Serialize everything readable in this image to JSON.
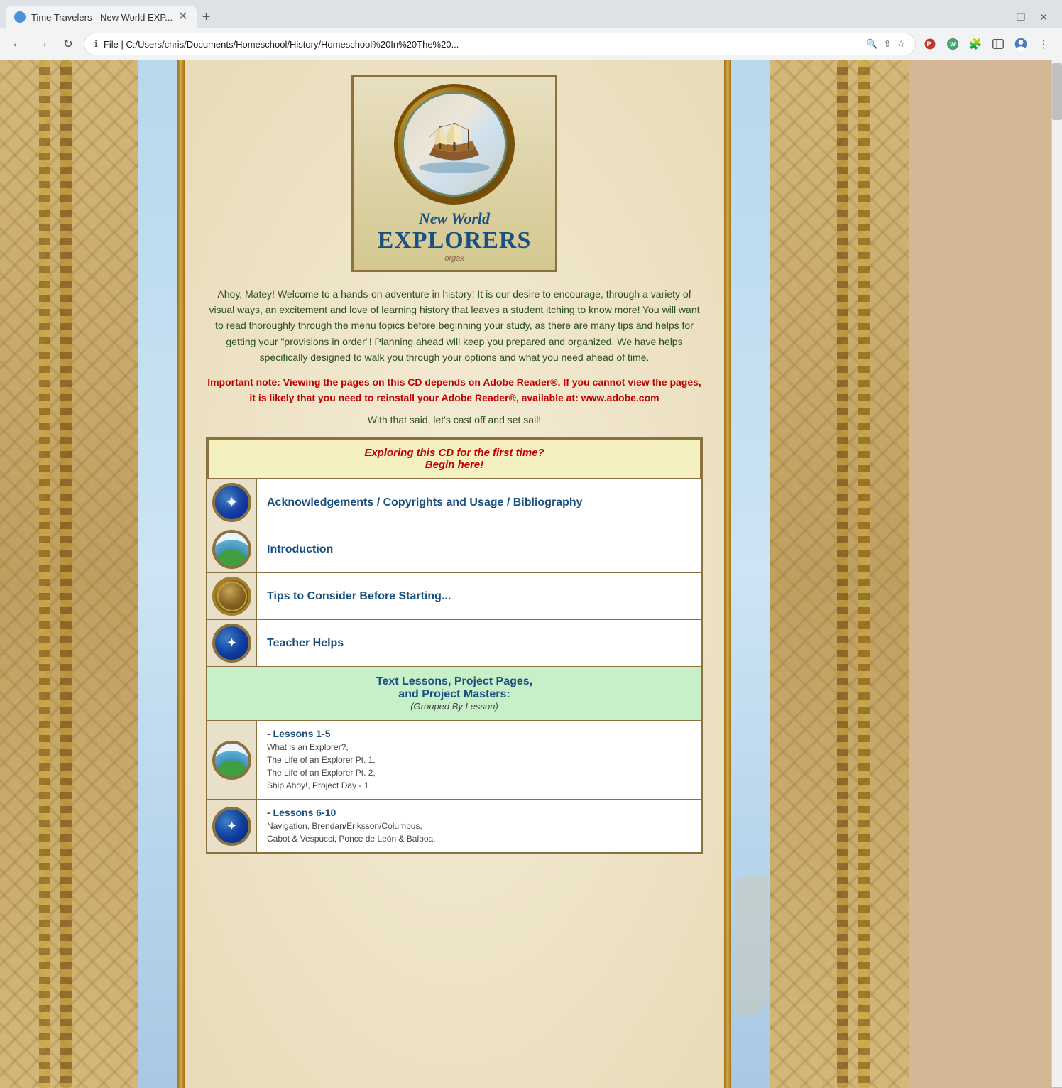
{
  "browser": {
    "tab_title": "Time Travelers - New World EXP...",
    "url": "File  |  C:/Users/chris/Documents/Homeschool/History/Homeschool%20In%20The%20...",
    "new_tab_label": "+",
    "favicon_alt": "browser-favicon"
  },
  "page": {
    "title_new_world": "New World",
    "title_explorers": "EXPLORERS",
    "title_small": "orgax",
    "welcome_text": "Ahoy, Matey! Welcome to a hands-on adventure in history! It is our desire to encourage, through a variety of visual ways, an excitement and love of learning history that leaves a student itching to know more! You will want to read thoroughly through the menu topics before beginning your study, as there are many tips and helps for getting your \"provisions in order\"! Planning ahead will keep you prepared and organized. We have helps specifically designed to walk you through your options and what you need ahead of time.",
    "important_note": "Important note: Viewing the pages on this CD depends on Adobe Reader®. If you cannot view the pages, it is likely that you need to reinstall your Adobe Reader®, available at: www.adobe.com",
    "cast_off": "With that said, let's cast off and set sail!",
    "first_time_header": "Exploring this CD for the first time?\nBegin here!",
    "nav_items": [
      {
        "label": "Acknowledgements / Copyrights and Usage / Bibliography",
        "icon_type": "stars-blue",
        "sub_items": []
      },
      {
        "label": "Introduction",
        "icon_type": "landscape",
        "sub_items": []
      },
      {
        "label": "Tips to Consider Before Starting...",
        "icon_type": "gold-porthole",
        "sub_items": []
      },
      {
        "label": "Teacher Helps",
        "icon_type": "stars-blue",
        "sub_items": []
      }
    ],
    "lessons_header": "Text Lessons, Project Pages,\nand Project Masters:",
    "lessons_sub": "(Grouped By Lesson)",
    "lesson_groups": [
      {
        "label": "- Lessons 1-5",
        "icon_type": "landscape",
        "sub_items": [
          "What is an Explorer?,",
          "The Life of an Explorer Pt. 1,",
          "The Life of an Explorer Pt. 2,",
          "Ship Ahoy!, Project Day - 1"
        ]
      },
      {
        "label": "- Lessons 6-10",
        "icon_type": "stars-blue",
        "sub_items": [
          "Navigation, Brendan/Eriksson/Columbus,",
          "Cabot & Vespucci, Ponce de León & Balboa,"
        ]
      }
    ]
  }
}
